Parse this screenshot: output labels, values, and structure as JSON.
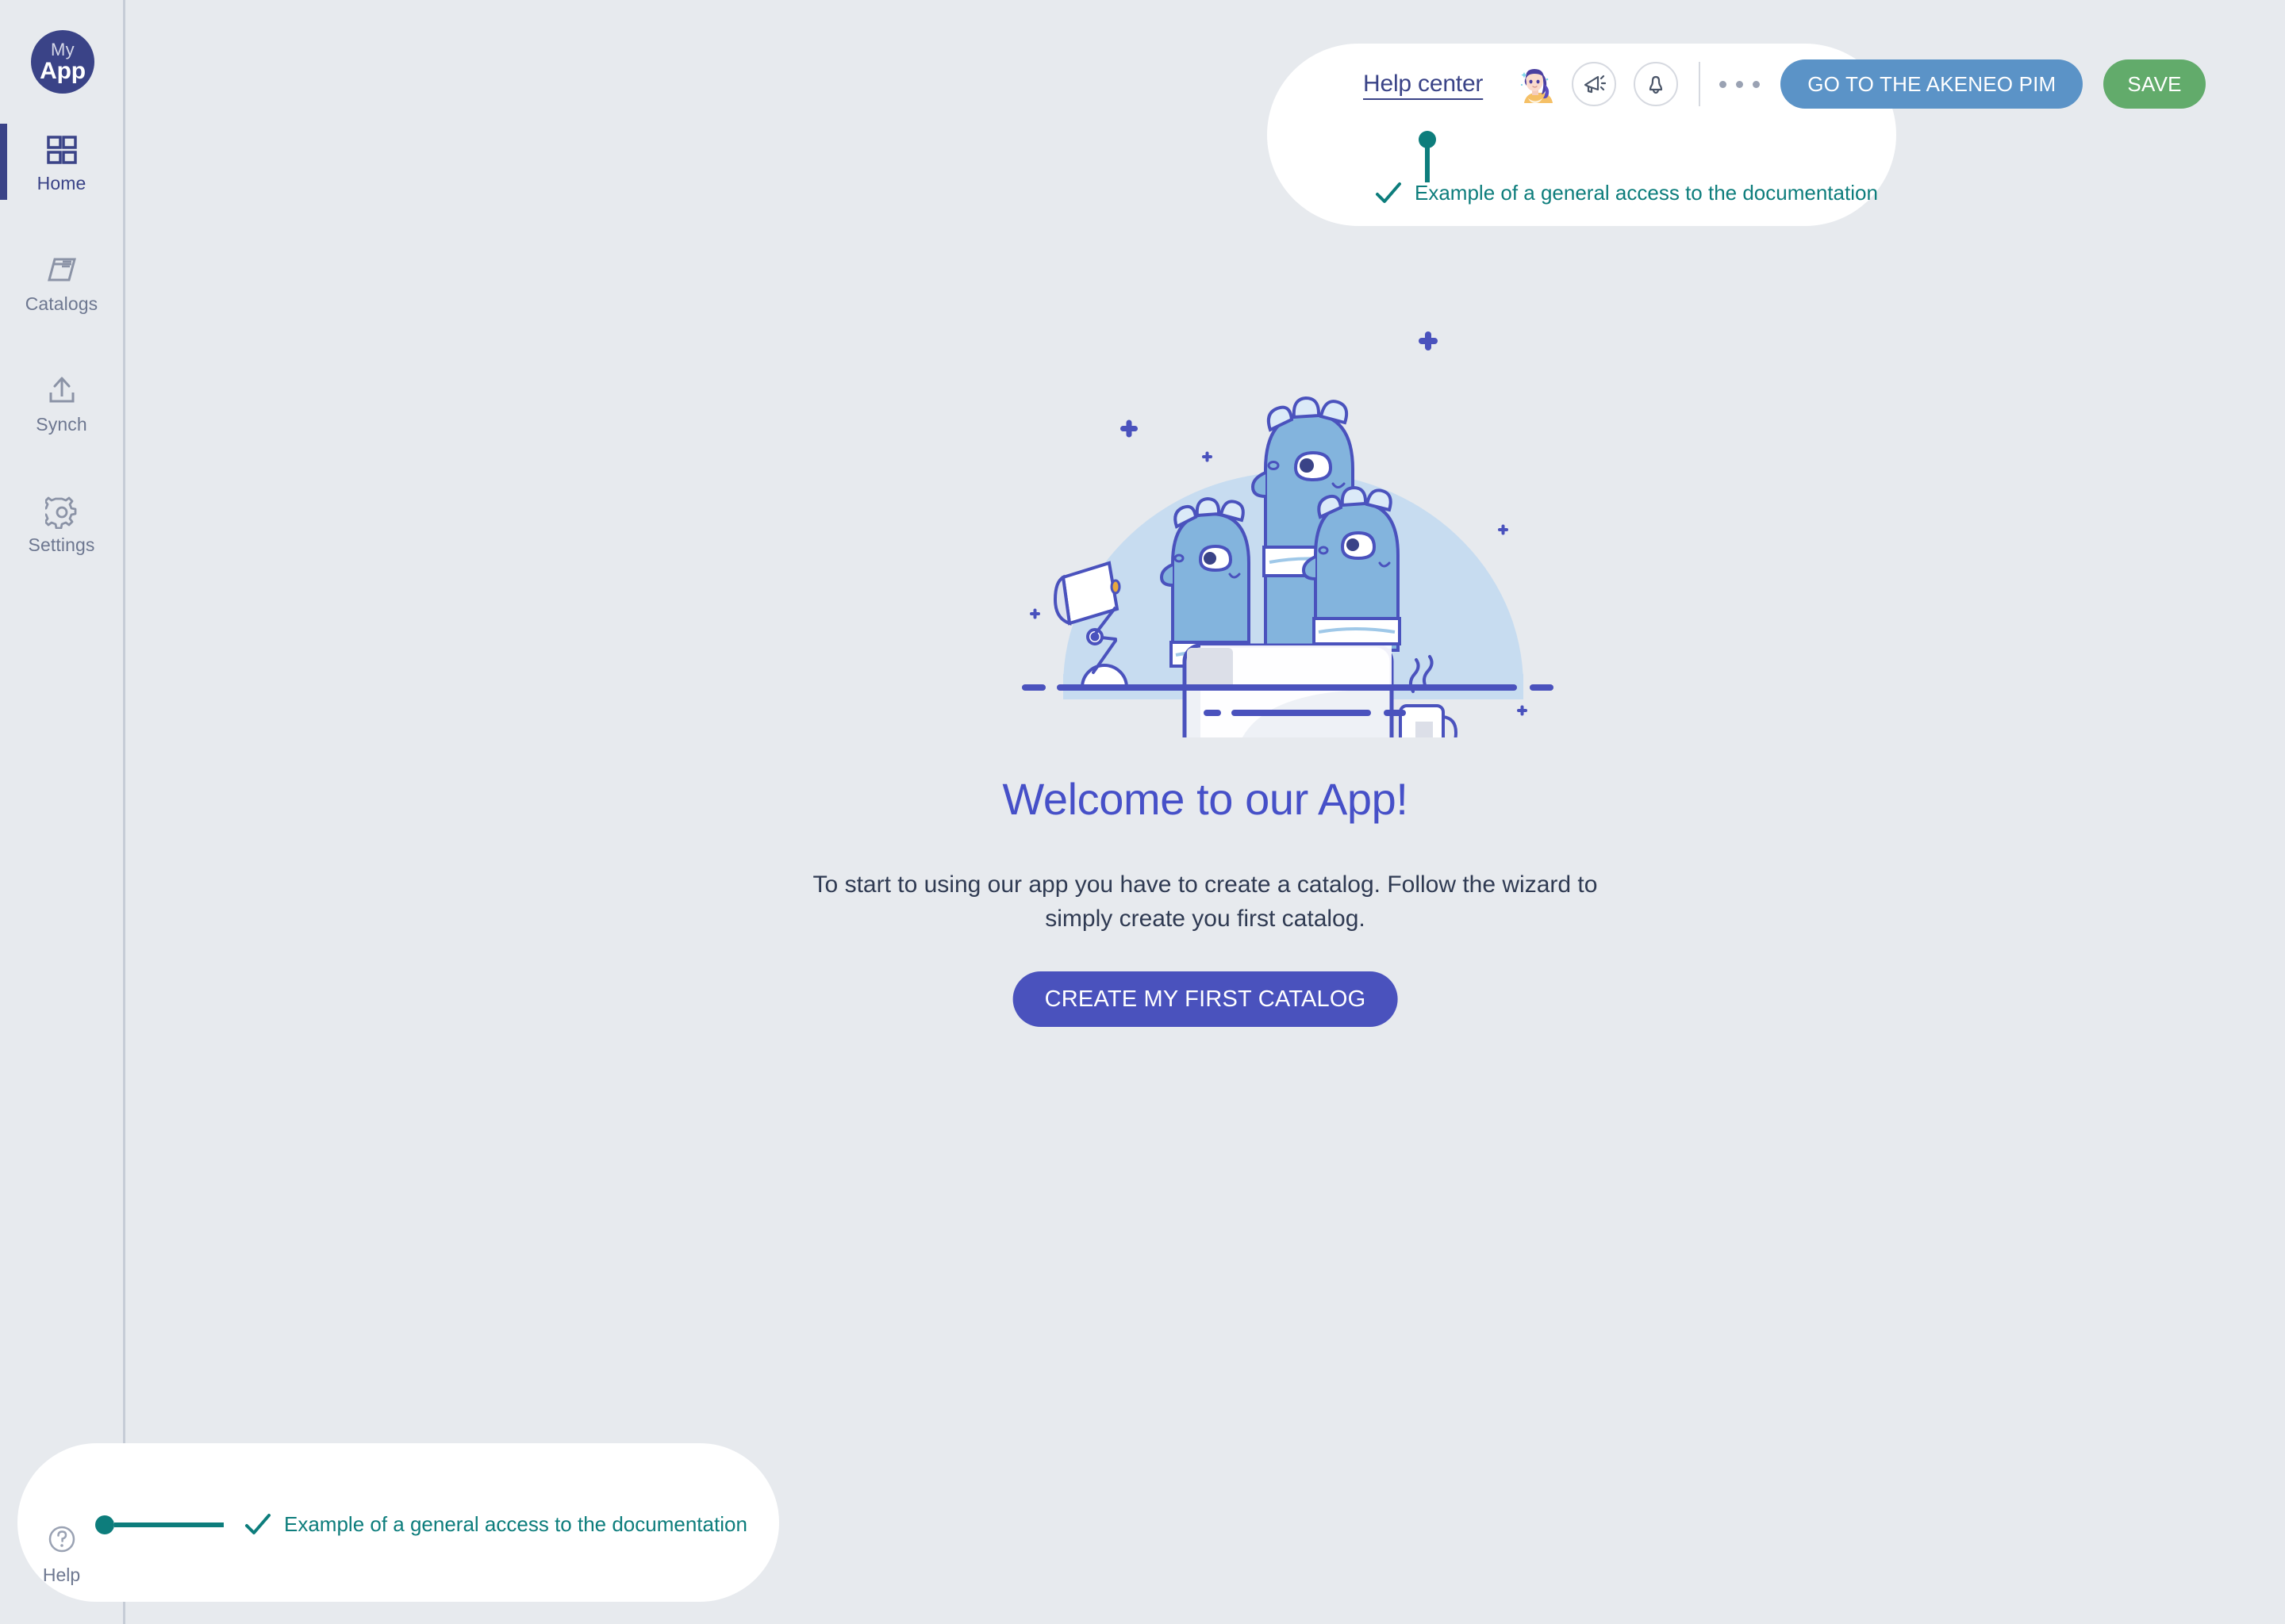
{
  "app": {
    "logo_line1": "My",
    "logo_line2": "App",
    "background_color": "#E7EAEE",
    "brand_color": "#3A4387",
    "accent_teal": "#0D7D7C"
  },
  "sidebar": {
    "items": [
      {
        "label": "Home",
        "icon": "grid-icon",
        "active": true
      },
      {
        "label": "Catalogs",
        "icon": "books-icon",
        "active": false
      },
      {
        "label": "Synch",
        "icon": "upload-icon",
        "active": false
      },
      {
        "label": "Settings",
        "icon": "gear-icon",
        "active": false
      }
    ],
    "help": {
      "label": "Help",
      "icon": "question-circle-icon"
    }
  },
  "header": {
    "help_center_label": "Help center",
    "avatar": "user-avatar",
    "announcement_icon": "megaphone-icon",
    "notification_icon": "bell-icon",
    "more_icon": "ellipsis-icon",
    "akeneo_button_label": "GO TO THE AKENEO PIM",
    "akeneo_button_color": "#5B93C7",
    "save_button_label": "SAVE",
    "save_button_color": "#62AB6B",
    "callout": {
      "text": "Example of a general access to the documentation",
      "check_icon": "check-icon",
      "color": "#0D7D7C"
    }
  },
  "help_callout": {
    "text": "Example of a general access to the documentation",
    "check_icon": "check-icon",
    "color": "#0D7D7C"
  },
  "main": {
    "illustration": "three-dinosaurs-laptop-illustration",
    "title": "Welcome to our App!",
    "title_color": "#4650C8",
    "subtitle": "To start to using our app you have to create a catalog. Follow the wizard to simply create you first catalog.",
    "cta_label": "CREATE MY FIRST CATALOG",
    "cta_color": "#4A52BD"
  }
}
